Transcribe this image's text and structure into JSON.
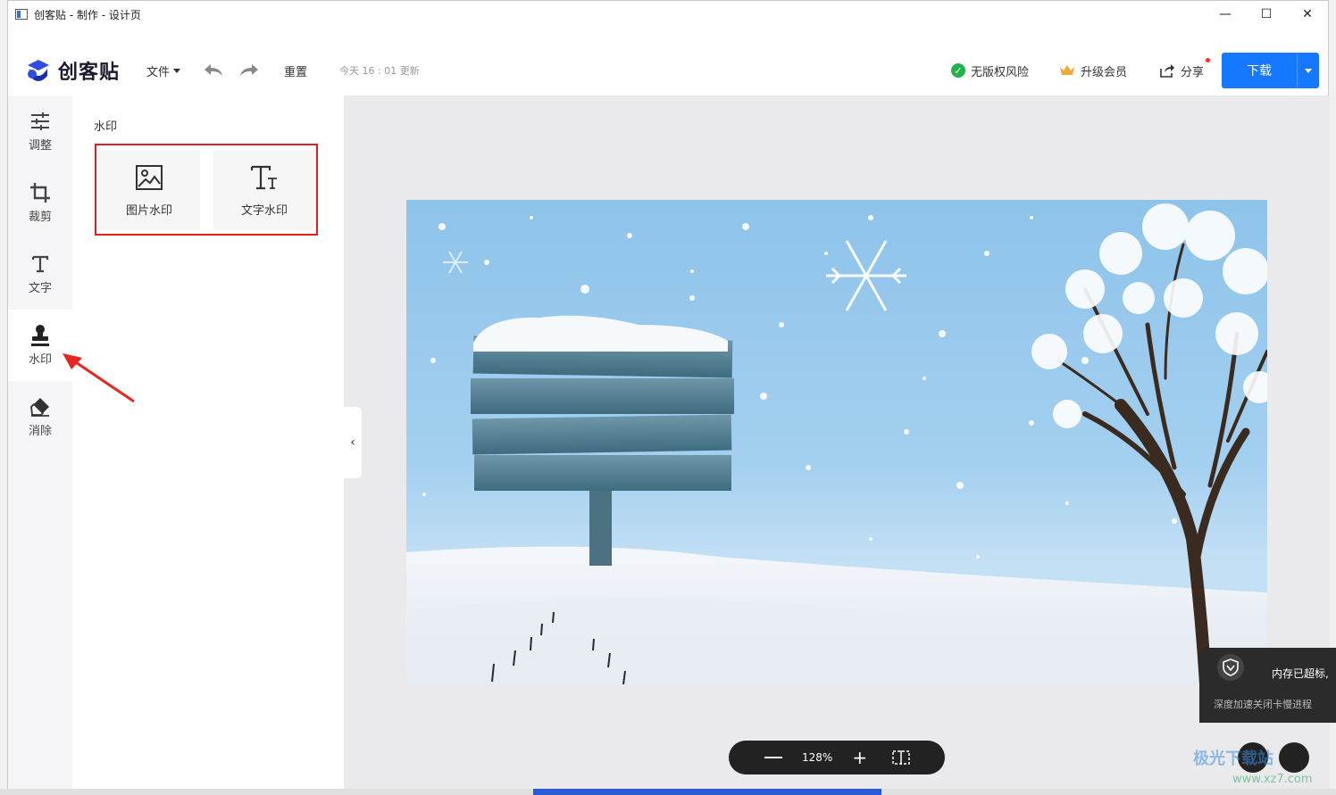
{
  "window": {
    "title": "创客贴 - 制作 - 设计页",
    "minimize": "—",
    "maximize": "☐",
    "close": "✕"
  },
  "header": {
    "logo_text": "创客贴",
    "file_menu": "文件",
    "reset": "重置",
    "updated": "今天 16 : 01 更新",
    "risk": "无版权风险",
    "vip": "升级会员",
    "share": "分享",
    "download": "下载",
    "colors": {
      "primary": "#1677ff",
      "success": "#21b24c",
      "highlight": "#e02020"
    }
  },
  "rail": {
    "items": [
      {
        "label": "调整",
        "icon": "sliders-icon"
      },
      {
        "label": "裁剪",
        "icon": "crop-icon"
      },
      {
        "label": "文字",
        "icon": "text-icon"
      },
      {
        "label": "水印",
        "icon": "stamp-icon",
        "active": true
      },
      {
        "label": "消除",
        "icon": "eraser-icon"
      }
    ]
  },
  "panel": {
    "title": "水印",
    "options": [
      {
        "label": "图片水印",
        "icon": "image-icon"
      },
      {
        "label": "文字水印",
        "icon": "text-size-icon"
      }
    ]
  },
  "zoom": {
    "value": "128%",
    "minus": "−",
    "plus": "+"
  },
  "toast": {
    "title": "内存已超标,",
    "subtitle": "深度加速关闭卡慢进程"
  },
  "site_watermark": {
    "main": "极光下载站",
    "sub": "www.xz7.com"
  }
}
